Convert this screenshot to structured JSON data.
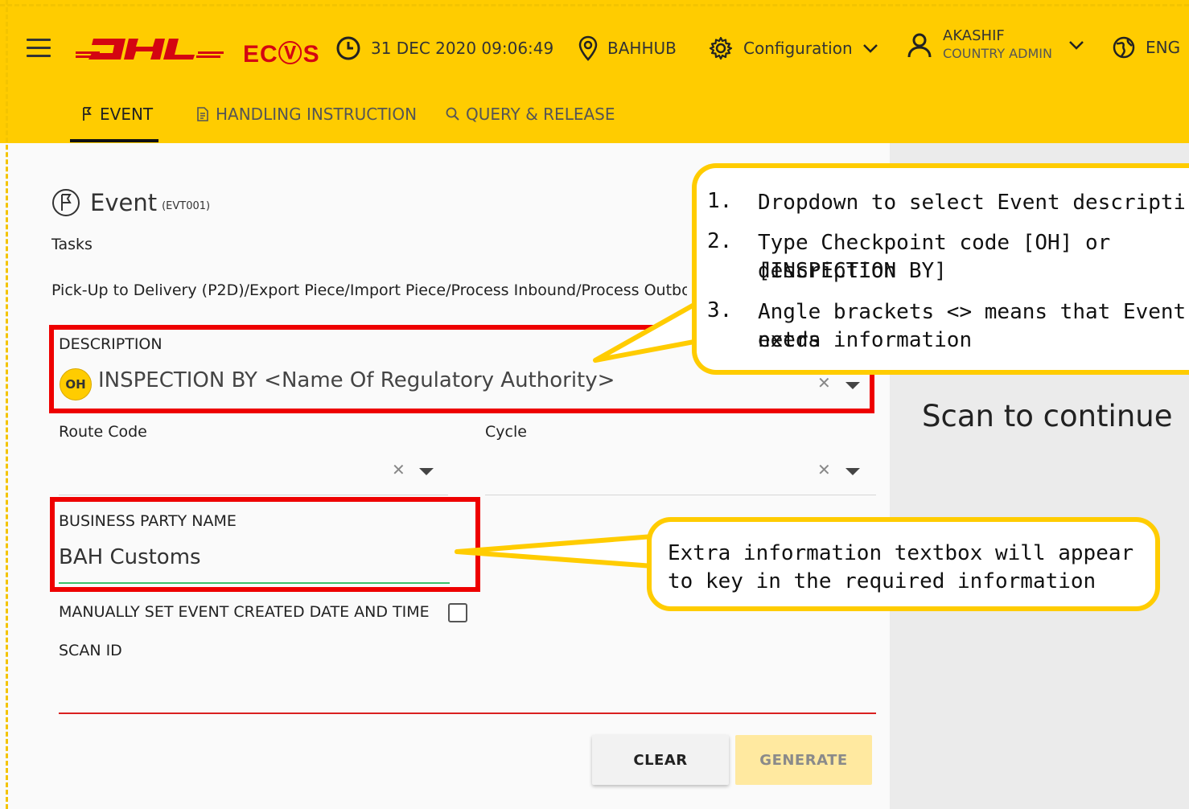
{
  "header": {
    "app_name": "ECⓋS",
    "datetime": "31 DEC 2020 09:06:49",
    "location": "BAHHUB",
    "configuration": "Configuration",
    "user_name": "AKASHIF",
    "user_role": "COUNTRY ADMIN",
    "language": "ENG",
    "brand_color": "#ffcc00",
    "logo_color": "#d40511"
  },
  "tabs": [
    {
      "label": "EVENT",
      "active": true
    },
    {
      "label": "HANDLING INSTRUCTION",
      "active": false
    },
    {
      "label": "QUERY & RELEASE",
      "active": false
    }
  ],
  "event": {
    "title": "Event",
    "code": "(EVT001)",
    "tasks_label": "Tasks",
    "tasks_value": "Pick-Up to Delivery (P2D)/Export Piece/Import Piece/Process Inbound/Process Outbound"
  },
  "form": {
    "description_label": "DESCRIPTION",
    "description_badge": "OH",
    "description_value": "INSPECTION BY <Name Of Regulatory Authority>",
    "route_code_label": "Route Code",
    "cycle_label": "Cycle",
    "business_party_label": "BUSINESS PARTY NAME",
    "business_party_value": "BAH Customs",
    "manual_date_label": "MANUALLY SET EVENT CREATED DATE AND TIME",
    "scan_id_label": "SCAN ID",
    "clear_button": "CLEAR",
    "generate_button": "GENERATE"
  },
  "right_panel": {
    "scan_text": "Scan to continue"
  },
  "callouts": {
    "c1_items": [
      {
        "num": "1.",
        "text": "Dropdown to select Event description"
      },
      {
        "num": "2.",
        "text": "Type Checkpoint code [OH] or description",
        "text2": "[INSPECTION BY]"
      },
      {
        "num": "3.",
        "text": "Angle brackets <> means that Event needs",
        "text2": "extra information"
      }
    ],
    "c2_text1": "Extra information textbox will appear",
    "c2_text2": "to key in the required information"
  }
}
